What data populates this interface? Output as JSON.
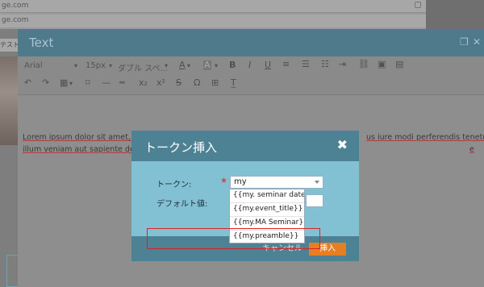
{
  "background": {
    "url_line1": "ge.com",
    "url_line2": "ge.com",
    "left_label": "テスト"
  },
  "editor": {
    "title": "Text",
    "font_name": "Arial",
    "font_size": "15px",
    "style_name": "ダブル スペ...",
    "lorem_line1": "Lorem ipsum dolor sit amet, con",
    "lorem_line1_right": "us iure modi perferendis tenetur ea",
    "lorem_line2": "illum veniam aut sapiente desero",
    "lorem_line2_right": "e"
  },
  "modal": {
    "title": "トークン挿入",
    "close_symbol": "✖",
    "token_label": "トークン:",
    "required_mark": "★",
    "token_value": "my",
    "default_label": "デフォルト値:",
    "default_value": "",
    "cancel_label": "キャンセル",
    "insert_label": "挿入"
  },
  "dropdown": {
    "options": [
      "{{my. seminar date}}",
      "{{my.event_title}}",
      "{{my.MA Seminar}}",
      "{{my.preamble}}"
    ]
  },
  "colors": {
    "modal_header": "#4d8294",
    "modal_body": "#82c0d4",
    "insert_button": "#e67e22",
    "highlight": "#e02020"
  }
}
